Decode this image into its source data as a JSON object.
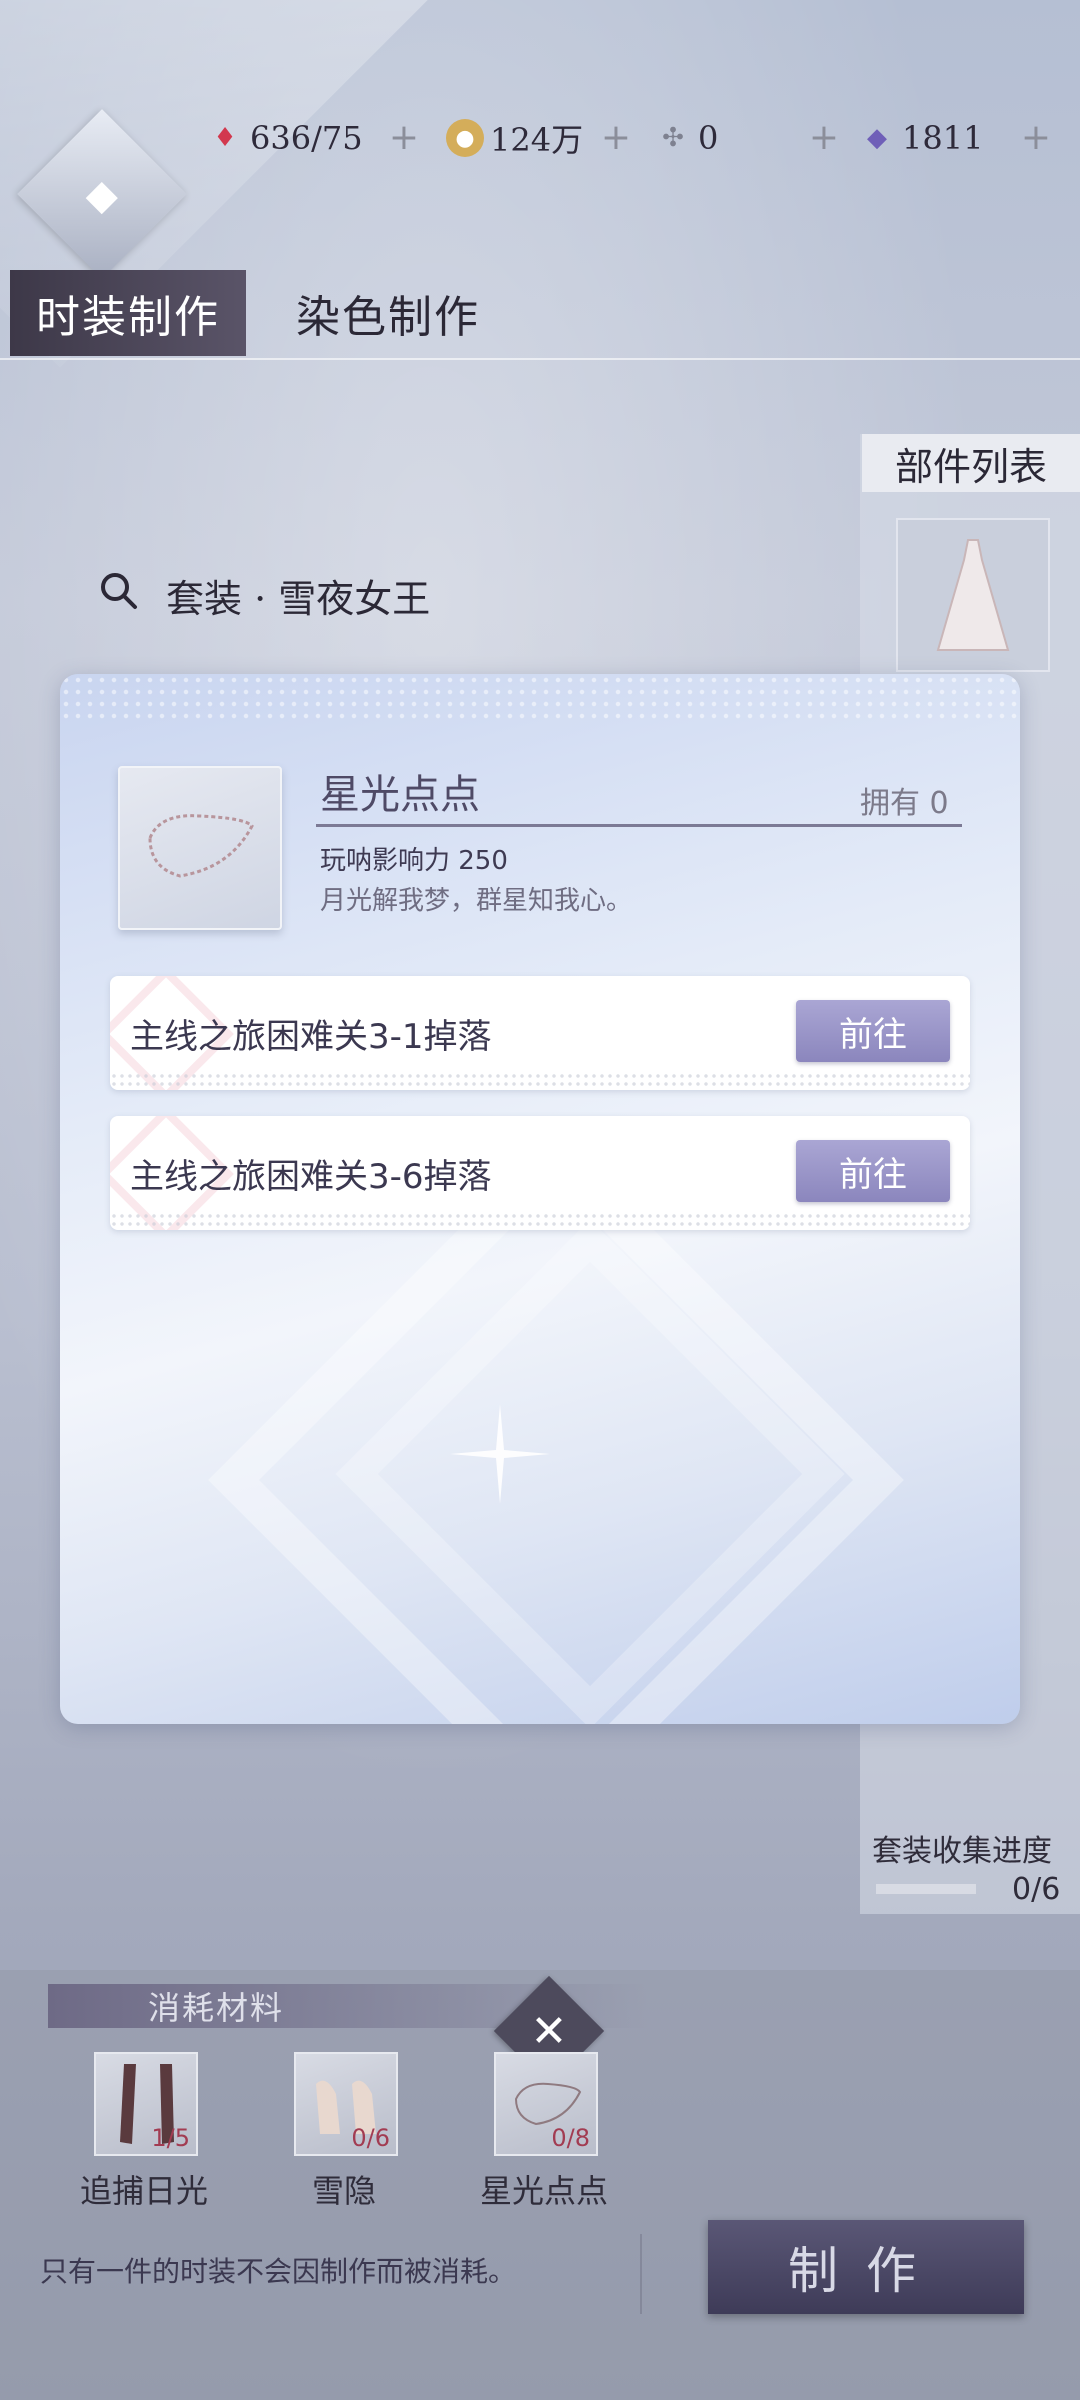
{
  "currency": {
    "stamina": {
      "value": "636/75",
      "icon": "heart-gem-icon",
      "color": "#d2384e"
    },
    "gold": {
      "value": "124万",
      "icon": "coin-icon",
      "color": "#c9a14a"
    },
    "ticket": {
      "value": "0",
      "icon": "ticket-icon",
      "color": "#8c8f9c"
    },
    "diamond": {
      "value": "1811",
      "icon": "diamond-icon",
      "color": "#6f5fb8"
    },
    "plus_label": "+"
  },
  "tabs": {
    "fashion_craft": "时装制作",
    "dye_craft": "染色制作"
  },
  "search": {
    "suite_label": "套装 · 雪夜女王"
  },
  "parts_panel": {
    "title": "部件列表",
    "progress_label": "套装收集进度",
    "progress_value": "0/6",
    "progress_fraction": 0
  },
  "modal": {
    "item_name": "星光点点",
    "owned_label": "拥有 0",
    "stat_label": "玩呐影响力  250",
    "description": "月光解我梦，群星知我心。",
    "sources": [
      {
        "label": "主线之旅困难关3-1掉落",
        "button": "前往"
      },
      {
        "label": "主线之旅困难关3-6掉落",
        "button": "前往"
      }
    ]
  },
  "materials": {
    "header": "消耗材料",
    "items": [
      {
        "name": "追捕日光",
        "count": "1/5"
      },
      {
        "name": "雪隐",
        "count": "0/6"
      },
      {
        "name": "星光点点",
        "count": "0/8"
      }
    ],
    "close_label": "✕"
  },
  "footer": {
    "note": "只有一件的时装不会因制作而被消耗。",
    "make_button": "制作"
  }
}
